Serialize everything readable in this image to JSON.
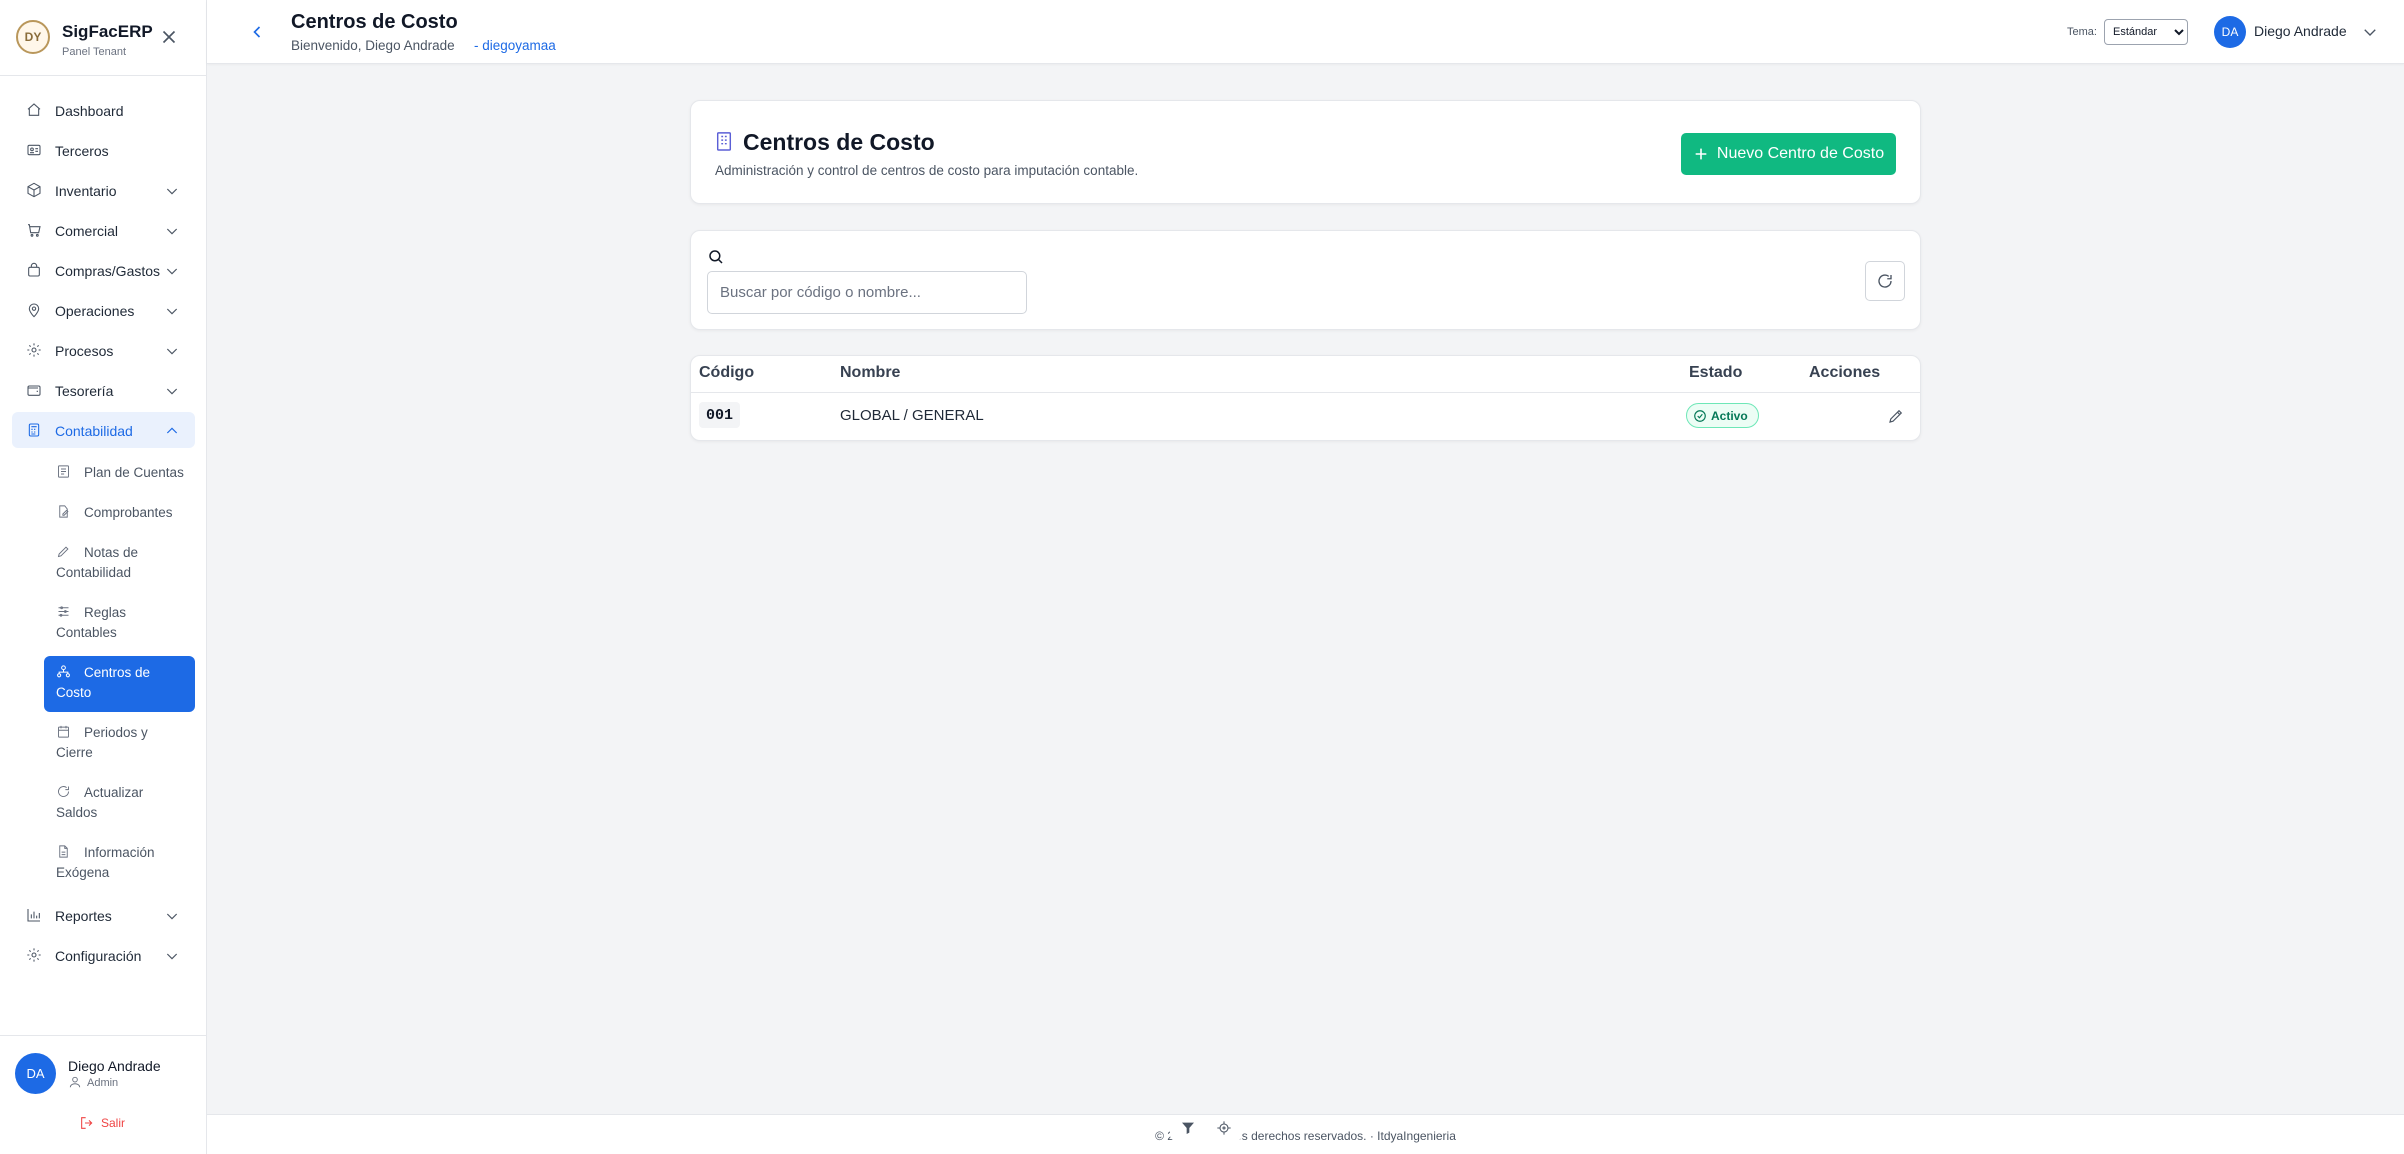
{
  "brand": {
    "name": "SigFacERP",
    "subtitle": "Panel Tenant",
    "logo_text": "DY"
  },
  "sidebar": {
    "items": [
      {
        "label": "Dashboard",
        "icon": "home-icon"
      },
      {
        "label": "Terceros",
        "icon": "id-card-icon"
      },
      {
        "label": "Inventario",
        "icon": "cube-icon"
      },
      {
        "label": "Comercial",
        "icon": "cart-icon"
      },
      {
        "label": "Compras/Gastos",
        "icon": "bag-icon"
      },
      {
        "label": "Operaciones",
        "icon": "map-pin-icon"
      },
      {
        "label": "Procesos",
        "icon": "gear-icon"
      },
      {
        "label": "Tesorería",
        "icon": "wallet-icon"
      },
      {
        "label": "Contabilidad",
        "icon": "calculator-icon"
      },
      {
        "label": "Reportes",
        "icon": "bar-chart-icon"
      },
      {
        "label": "Configuración",
        "icon": "gear-icon"
      }
    ],
    "contabilidad_sub": [
      {
        "label": "Plan de Cuentas",
        "icon": "list-icon"
      },
      {
        "label": "Comprobantes",
        "icon": "document-edit-icon"
      },
      {
        "label": "Notas de Contabilidad",
        "icon": "pencil-icon"
      },
      {
        "label": "Reglas Contables",
        "icon": "sliders-icon"
      },
      {
        "label": "Centros de Costo",
        "icon": "hierarchy-icon"
      },
      {
        "label": "Periodos y Cierre",
        "icon": "calendar-icon"
      },
      {
        "label": "Actualizar Saldos",
        "icon": "refresh-icon"
      },
      {
        "label": "Información Exógena",
        "icon": "file-icon"
      }
    ]
  },
  "user": {
    "initials": "DA",
    "name": "Diego Andrade",
    "role": "Admin",
    "logout_label": "Salir"
  },
  "header": {
    "title": "Centros de Costo",
    "welcome": "Bienvenido, Diego Andrade",
    "username_link": "- diegoyamaa",
    "theme_label": "Tema:",
    "theme_value": "Estándar",
    "user_name": "Diego Andrade",
    "user_initials": "DA"
  },
  "page": {
    "title": "Centros de Costo",
    "subtitle": "Administración y control de centros de costo para imputación contable.",
    "new_button": "Nuevo Centro de Costo",
    "search_placeholder": "Buscar por código o nombre..."
  },
  "table": {
    "headers": [
      "Código",
      "Nombre",
      "Estado",
      "Acciones"
    ],
    "rows": [
      {
        "code": "001",
        "name": "GLOBAL / GENERAL",
        "status": "Activo"
      }
    ]
  },
  "footer": {
    "text": "© 2026 Todos los derechos reservados. · ItdyaIngenieria"
  },
  "colors": {
    "accent": "#1d6ae5",
    "primary_button": "#10b981",
    "status_active": "#047857",
    "background": "#f3f4f6"
  }
}
